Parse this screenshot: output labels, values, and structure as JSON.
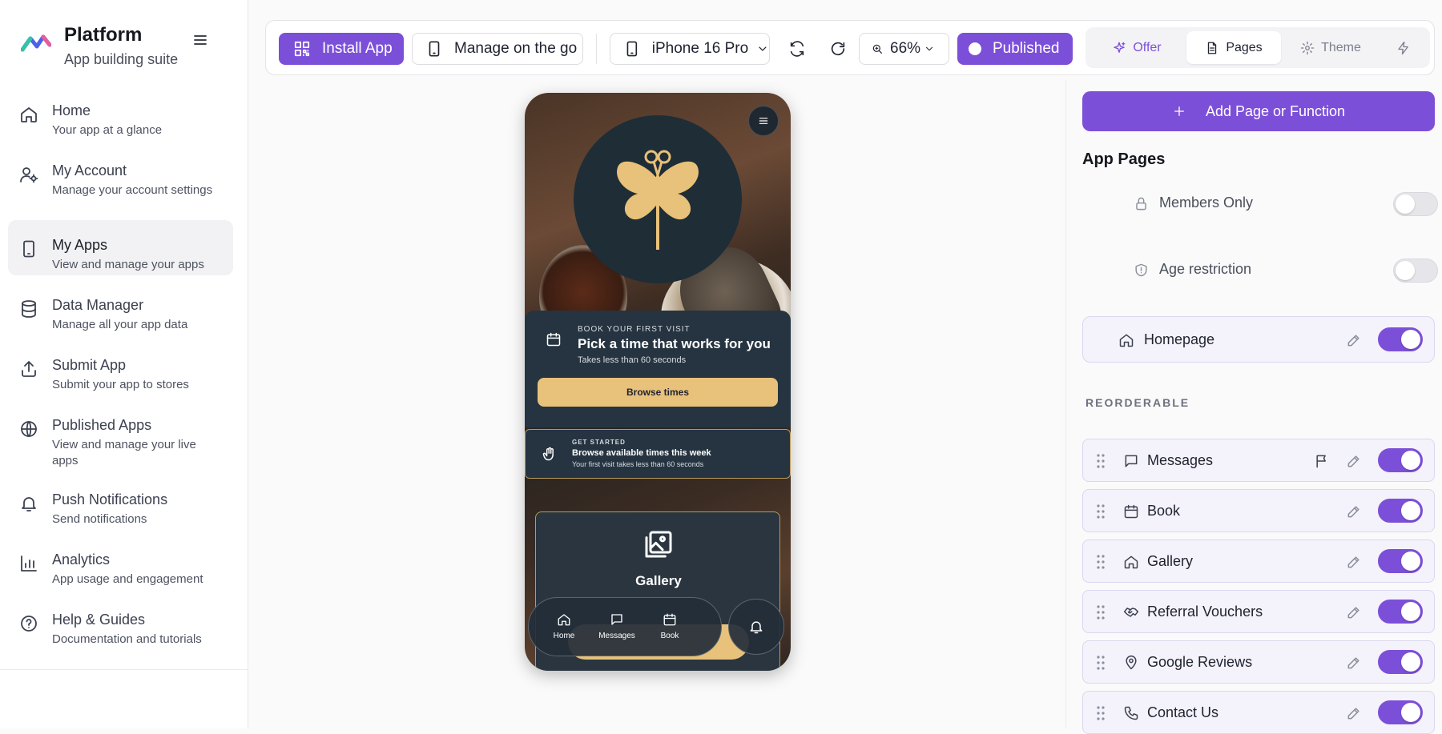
{
  "sidebar": {
    "brand": {
      "title": "Platform",
      "subtitle": "App building suite"
    },
    "items": [
      {
        "label": "Home",
        "desc": "Your app at a glance",
        "icon": "home-icon",
        "active": false
      },
      {
        "label": "My Account",
        "desc": "Manage your account settings",
        "icon": "user-settings-icon",
        "active": false
      },
      {
        "label": "My Apps",
        "desc": "View and manage your apps",
        "icon": "phone-icon",
        "active": true
      },
      {
        "label": "Data Manager",
        "desc": "Manage all your app data",
        "icon": "database-icon",
        "active": false
      },
      {
        "label": "Submit App",
        "desc": "Submit your app to stores",
        "icon": "upload-icon",
        "active": false
      },
      {
        "label": "Published Apps",
        "desc": "View and manage your live apps",
        "icon": "globe-icon",
        "active": false
      },
      {
        "label": "Push Notifications",
        "desc": "Send notifications",
        "icon": "bell-icon",
        "active": false
      },
      {
        "label": "Analytics",
        "desc": "App usage and engagement",
        "icon": "bar-chart-icon",
        "active": false
      },
      {
        "label": "Help & Guides",
        "desc": "Documentation and tutorials",
        "icon": "help-circle-icon",
        "active": false
      }
    ]
  },
  "toolbar": {
    "install_label": "Install App",
    "manage_label": "Manage on the go",
    "device_label": "iPhone 16 Pro",
    "zoom_label": "66%",
    "published_label": "Published",
    "tabs": {
      "offer": "Offer",
      "pages": "Pages",
      "theme": "Theme"
    },
    "active_tab": "Pages"
  },
  "phone": {
    "book_card": {
      "eyebrow": "BOOK YOUR FIRST VISIT",
      "title": "Pick a time that works for you",
      "subtitle": "Takes less than 60 seconds",
      "button": "Browse times"
    },
    "start_card": {
      "eyebrow": "GET STARTED",
      "title": "Browse available times this week",
      "subtitle": "Your first visit takes less than 60 seconds"
    },
    "gallery_label": "Gallery",
    "tabbar": {
      "home": "Home",
      "messages": "Messages",
      "book": "Book"
    }
  },
  "panel": {
    "add_button": "Add Page or Function",
    "title": "App Pages",
    "settings": [
      {
        "label": "Members Only",
        "icon": "lock-icon",
        "on": false
      },
      {
        "label": "Age restriction",
        "icon": "shield-icon",
        "on": false
      }
    ],
    "homepage": {
      "label": "Homepage",
      "on": true
    },
    "reorderable_label": "REORDERABLE",
    "pages": [
      {
        "label": "Messages",
        "icon": "message-icon",
        "on": true,
        "flag": true
      },
      {
        "label": "Book",
        "icon": "calendar-icon",
        "on": true,
        "flag": false
      },
      {
        "label": "Gallery",
        "icon": "home-icon",
        "on": true,
        "flag": false
      },
      {
        "label": "Referral Vouchers",
        "icon": "handshake-icon",
        "on": true,
        "flag": false
      },
      {
        "label": "Google Reviews",
        "icon": "map-pin-icon",
        "on": true,
        "flag": false
      },
      {
        "label": "Contact Us",
        "icon": "phone-call-icon",
        "on": true,
        "flag": false
      }
    ]
  },
  "colors": {
    "accent": "#7c4fd8",
    "gold": "#e8c17a",
    "card": "#253440"
  }
}
